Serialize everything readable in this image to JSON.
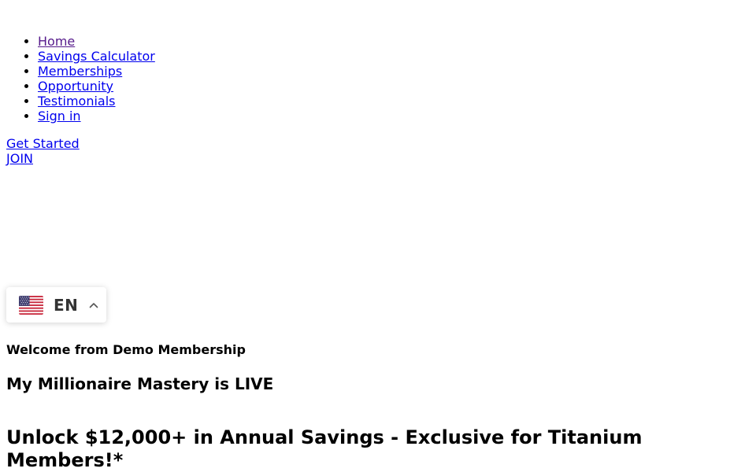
{
  "nav": {
    "items": [
      {
        "label": "Home"
      },
      {
        "label": "Savings Calculator"
      },
      {
        "label": "Memberships"
      },
      {
        "label": "Opportunity"
      },
      {
        "label": "Testimonials"
      },
      {
        "label": "Sign in"
      }
    ]
  },
  "cta": {
    "get_started": "Get Started",
    "join": "JOIN"
  },
  "language": {
    "code": "EN",
    "flag_icon": "us-flag-icon",
    "chevron_icon": "chevron-up-icon"
  },
  "content": {
    "welcome": "Welcome from Demo Membership",
    "live_heading": "My Millionaire Mastery is LIVE",
    "savings_heading": "Unlock $12,000+ in Annual Savings - Exclusive for Titanium Members!*"
  },
  "colors": {
    "link": "#0000ee",
    "visited_link": "#551a8b"
  }
}
